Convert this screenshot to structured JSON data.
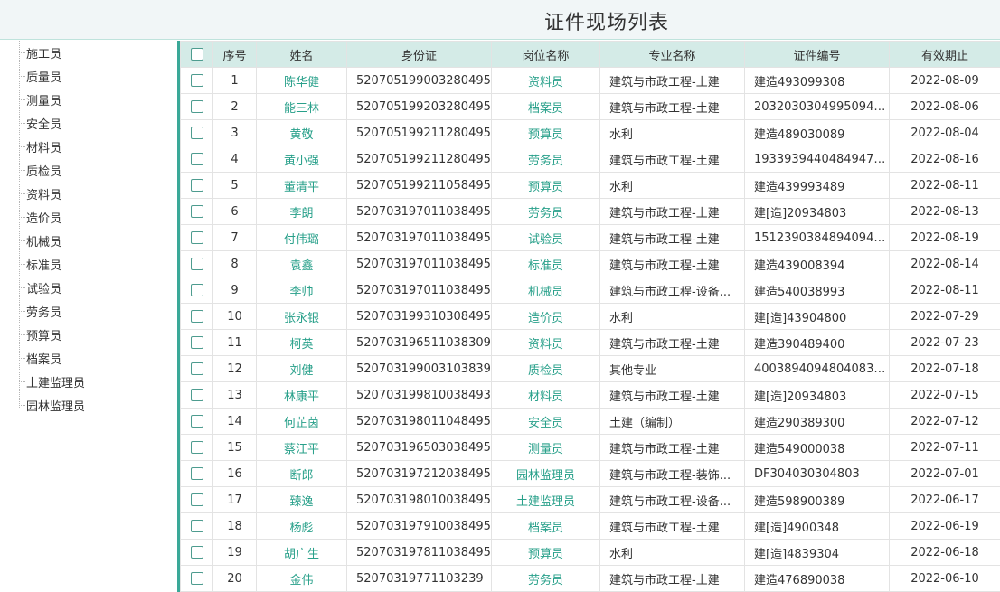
{
  "title": "证件现场列表",
  "sidebar": {
    "items": [
      "施工员",
      "质量员",
      "测量员",
      "安全员",
      "材料员",
      "质检员",
      "资料员",
      "造价员",
      "机械员",
      "标准员",
      "试验员",
      "劳务员",
      "预算员",
      "档案员",
      "土建监理员",
      "园林监理员"
    ]
  },
  "table": {
    "columns": {
      "seq": "序号",
      "name": "姓名",
      "id_card": "身份证",
      "position": "岗位名称",
      "major": "专业名称",
      "cert_no": "证件编号",
      "expiry": "有效期止"
    },
    "rows": [
      {
        "seq": "1",
        "name": "陈华健",
        "id_card": "520705199003280495",
        "position": "资料员",
        "major": "建筑与市政工程-土建",
        "cert_no": "建造493099308",
        "expiry": "2022-08-09"
      },
      {
        "seq": "2",
        "name": "能三林",
        "id_card": "520705199203280495",
        "position": "档案员",
        "major": "建筑与市政工程-土建",
        "cert_no": "20320303049950945...",
        "expiry": "2022-08-06"
      },
      {
        "seq": "3",
        "name": "黄敬",
        "id_card": "520705199211280495",
        "position": "预算员",
        "major": "水利",
        "cert_no": "建造489030089",
        "expiry": "2022-08-04"
      },
      {
        "seq": "4",
        "name": "黄小强",
        "id_card": "520705199211280495",
        "position": "劳务员",
        "major": "建筑与市政工程-土建",
        "cert_no": "19339394404849474...",
        "expiry": "2022-08-16"
      },
      {
        "seq": "5",
        "name": "董清平",
        "id_card": "520705199211058495",
        "position": "预算员",
        "major": "水利",
        "cert_no": "建造439993489",
        "expiry": "2022-08-11"
      },
      {
        "seq": "6",
        "name": "李朗",
        "id_card": "520703197011038495",
        "position": "劳务员",
        "major": "建筑与市政工程-土建",
        "cert_no": "建[造]20934803",
        "expiry": "2022-08-13"
      },
      {
        "seq": "7",
        "name": "付伟璐",
        "id_card": "520703197011038495",
        "position": "试验员",
        "major": "建筑与市政工程-土建",
        "cert_no": "15123903848940948...",
        "expiry": "2022-08-19"
      },
      {
        "seq": "8",
        "name": "袁鑫",
        "id_card": "520703197011038495",
        "position": "标准员",
        "major": "建筑与市政工程-土建",
        "cert_no": "建造439008394",
        "expiry": "2022-08-14"
      },
      {
        "seq": "9",
        "name": "李帅",
        "id_card": "520703197011038495",
        "position": "机械员",
        "major": "建筑与市政工程-设备...",
        "cert_no": "建造540038993",
        "expiry": "2022-08-11"
      },
      {
        "seq": "10",
        "name": "张永银",
        "id_card": "520703199310308495",
        "position": "造价员",
        "major": "水利",
        "cert_no": "建[造]43904800",
        "expiry": "2022-07-29"
      },
      {
        "seq": "11",
        "name": "柯英",
        "id_card": "520703196511038309",
        "position": "资料员",
        "major": "建筑与市政工程-土建",
        "cert_no": "建造390489400",
        "expiry": "2022-07-23"
      },
      {
        "seq": "12",
        "name": "刘健",
        "id_card": "520703199003103839",
        "position": "质检员",
        "major": "其他专业",
        "cert_no": "40038940948040830...",
        "expiry": "2022-07-18"
      },
      {
        "seq": "13",
        "name": "林康平",
        "id_card": "520703199810038493",
        "position": "材料员",
        "major": "建筑与市政工程-土建",
        "cert_no": "建[造]20934803",
        "expiry": "2022-07-15"
      },
      {
        "seq": "14",
        "name": "何芷茵",
        "id_card": "520703198011048495",
        "position": "安全员",
        "major": "土建（编制）",
        "cert_no": "建造290389300",
        "expiry": "2022-07-12"
      },
      {
        "seq": "15",
        "name": "蔡江平",
        "id_card": "520703196503038495",
        "position": "测量员",
        "major": "建筑与市政工程-土建",
        "cert_no": "建造549000038",
        "expiry": "2022-07-11"
      },
      {
        "seq": "16",
        "name": "断郎",
        "id_card": "520703197212038495",
        "position": "园林监理员",
        "major": "建筑与市政工程-装饰...",
        "cert_no": "DF304030304803",
        "expiry": "2022-07-01"
      },
      {
        "seq": "17",
        "name": "臻逸",
        "id_card": "520703198010038495",
        "position": "土建监理员",
        "major": "建筑与市政工程-设备...",
        "cert_no": "建造598900389",
        "expiry": "2022-06-17"
      },
      {
        "seq": "18",
        "name": "杨彪",
        "id_card": "520703197910038495",
        "position": "档案员",
        "major": "建筑与市政工程-土建",
        "cert_no": "建[造]4900348",
        "expiry": "2022-06-19"
      },
      {
        "seq": "19",
        "name": "胡广生",
        "id_card": "520703197811038495",
        "position": "预算员",
        "major": "水利",
        "cert_no": "建[造]4839304",
        "expiry": "2022-06-18"
      },
      {
        "seq": "20",
        "name": "金伟",
        "id_card": "52070319771103239",
        "position": "劳务员",
        "major": "建筑与市政工程-土建",
        "cert_no": "建造476890038",
        "expiry": "2022-06-10"
      }
    ]
  },
  "colors": {
    "accent": "#3aa898",
    "link": "#28a08a",
    "header_bg": "#d4ebe7",
    "title_bg": "#f1f6f7"
  }
}
